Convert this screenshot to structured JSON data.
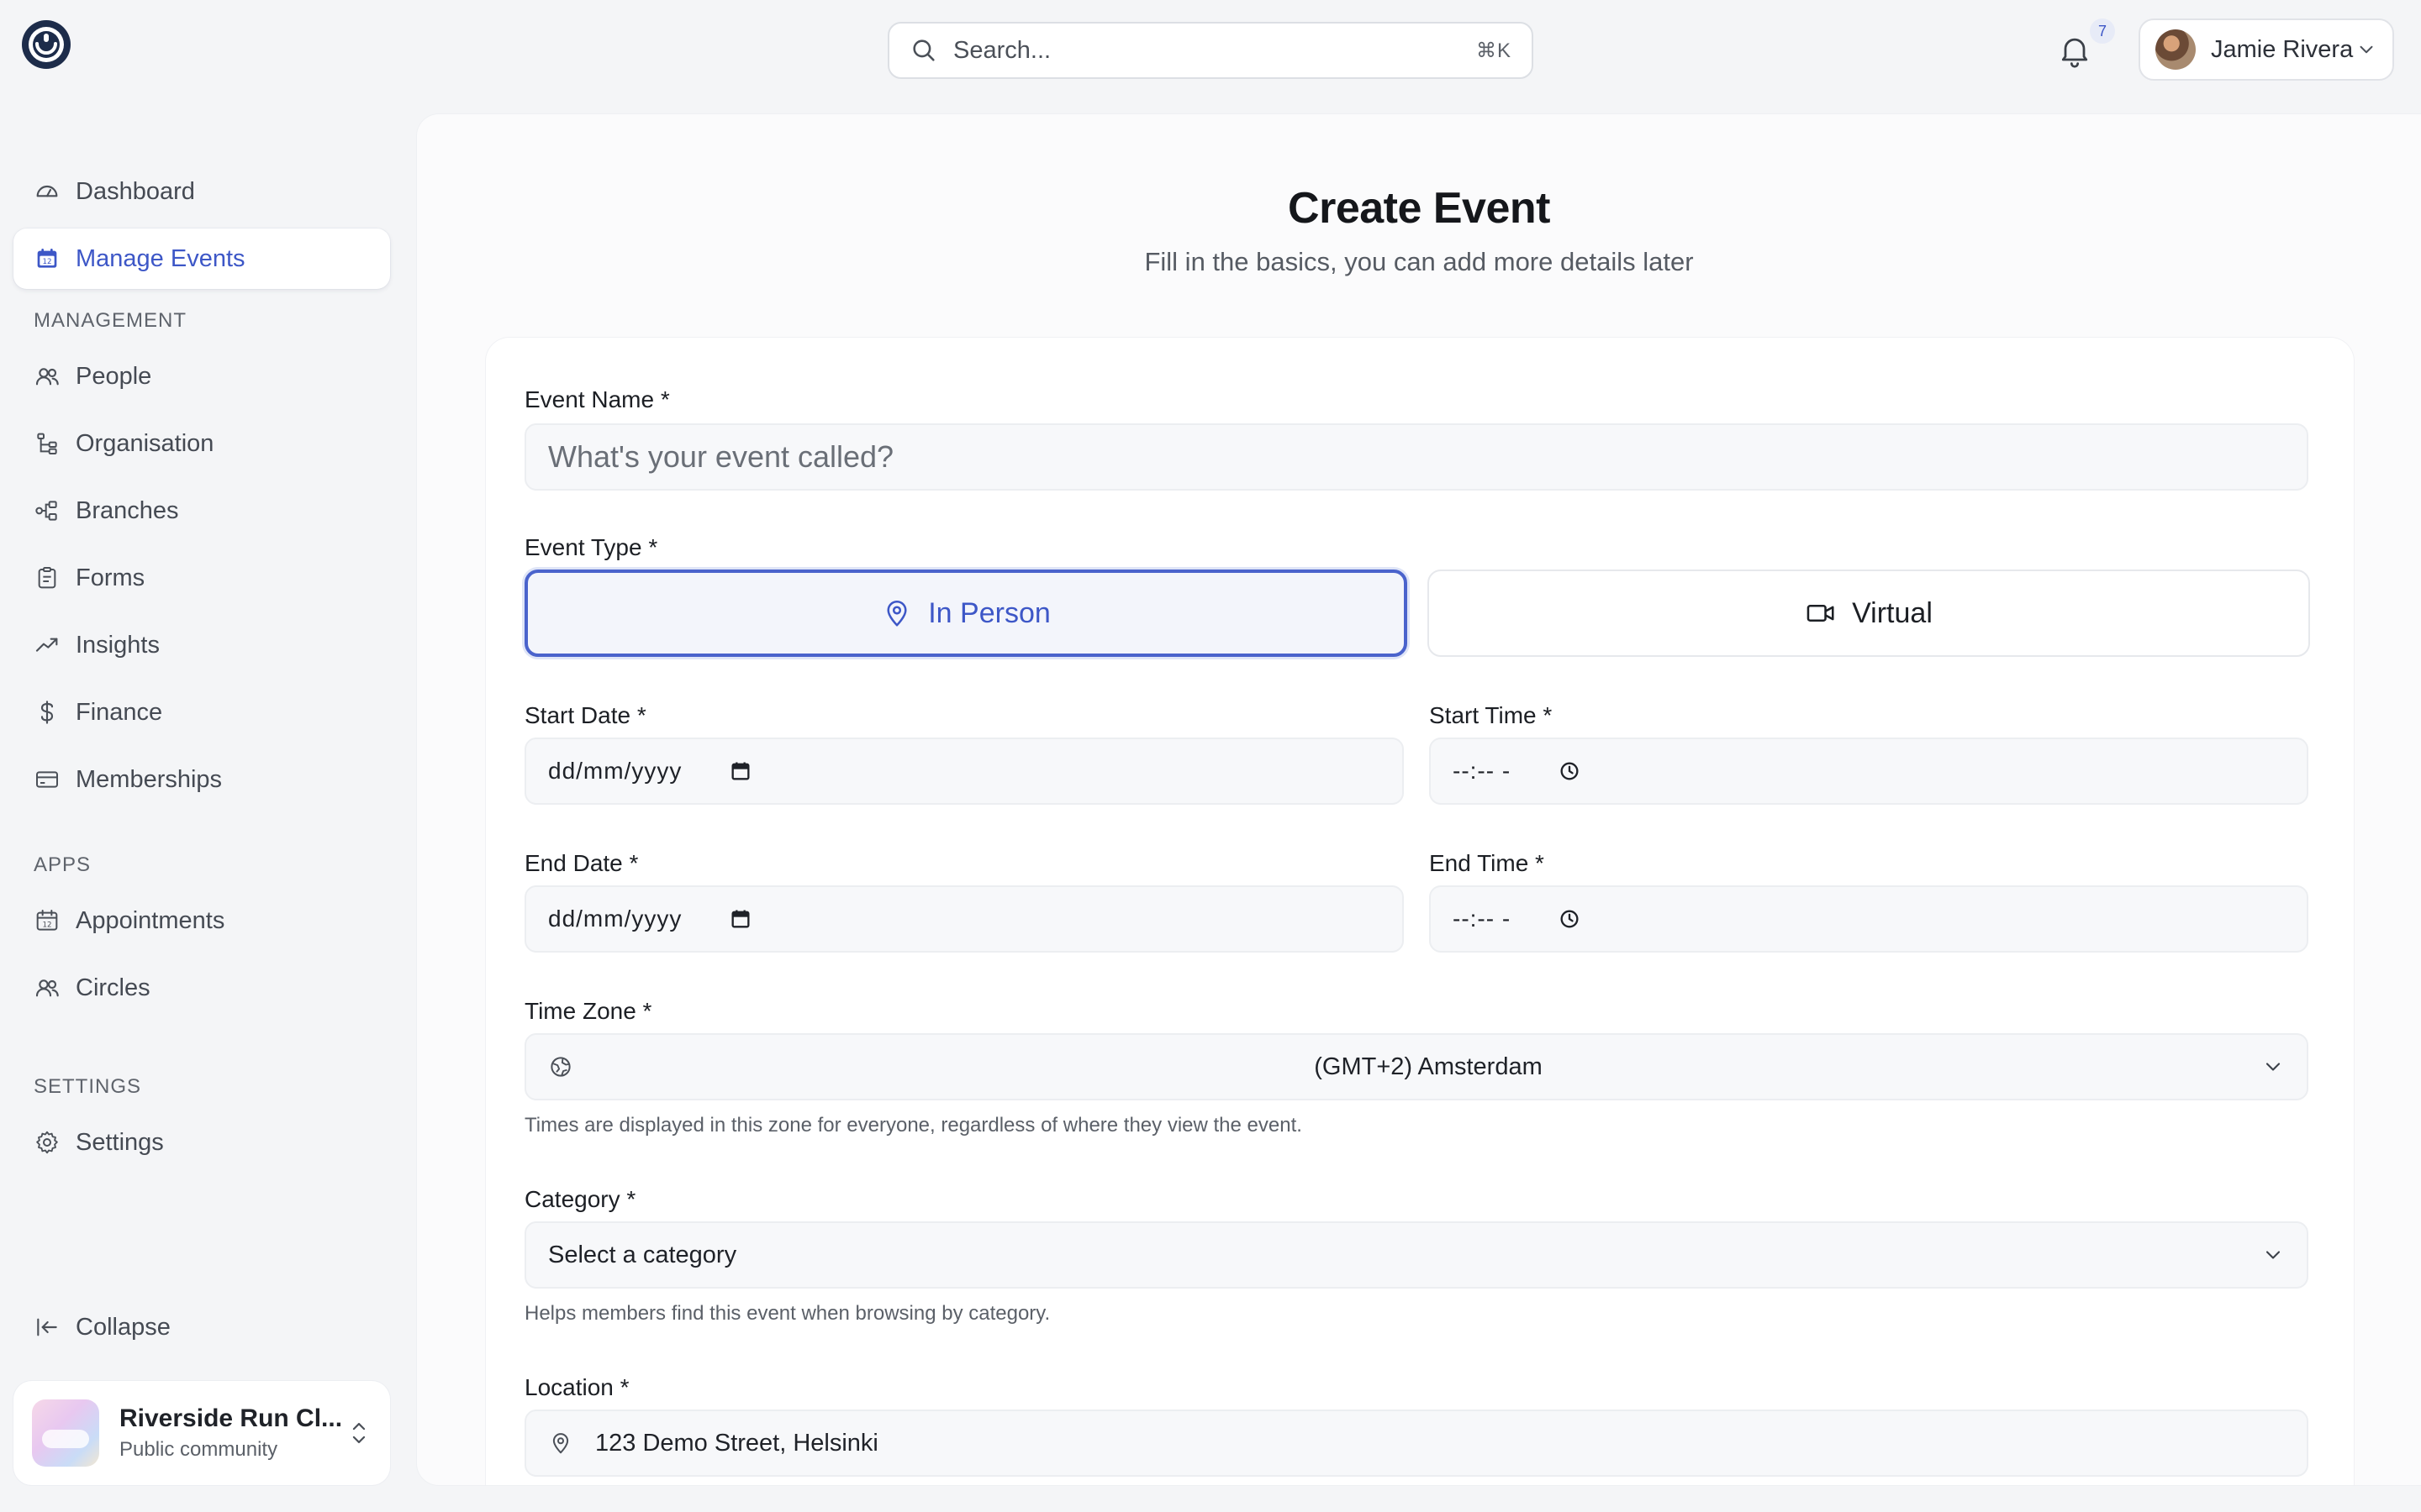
{
  "header": {
    "search_placeholder": "Search...",
    "search_shortcut": "⌘K",
    "notification_count": "7",
    "user_name": "Jamie Rivera"
  },
  "sidebar": {
    "top_items": [
      {
        "label": "Dashboard",
        "icon": "gauge-icon"
      },
      {
        "label": "Manage Events",
        "icon": "calendar-icon",
        "active": true
      }
    ],
    "sections": [
      {
        "title": "MANAGEMENT",
        "items": [
          {
            "label": "People",
            "icon": "people-icon"
          },
          {
            "label": "Organisation",
            "icon": "hierarchy-icon"
          },
          {
            "label": "Branches",
            "icon": "branches-icon"
          },
          {
            "label": "Forms",
            "icon": "clipboard-icon"
          },
          {
            "label": "Insights",
            "icon": "trend-icon"
          },
          {
            "label": "Finance",
            "icon": "dollar-icon"
          },
          {
            "label": "Memberships",
            "icon": "card-icon"
          }
        ]
      },
      {
        "title": "APPS",
        "items": [
          {
            "label": "Appointments",
            "icon": "calendar-icon"
          },
          {
            "label": "Circles",
            "icon": "people-icon"
          }
        ]
      },
      {
        "title": "SETTINGS",
        "items": [
          {
            "label": "Settings",
            "icon": "gear-icon"
          }
        ]
      }
    ],
    "collapse_label": "Collapse",
    "community": {
      "name": "Riverside Run Cl...",
      "subtitle": "Public community"
    }
  },
  "form": {
    "title": "Create Event",
    "subtitle": "Fill in the basics, you can add more details later",
    "event_name": {
      "label": "Event Name *",
      "placeholder": "What's your event called?"
    },
    "event_type": {
      "label": "Event Type *",
      "options": [
        {
          "label": "In Person",
          "icon": "location-pin-icon",
          "selected": true
        },
        {
          "label": "Virtual",
          "icon": "video-camera-icon",
          "selected": false
        }
      ]
    },
    "start_date": {
      "label": "Start Date *",
      "placeholder": "dd/mm/yyyy"
    },
    "start_time": {
      "label": "Start Time *",
      "placeholder": "--:-- -"
    },
    "end_date": {
      "label": "End Date *",
      "placeholder": "dd/mm/yyyy"
    },
    "end_time": {
      "label": "End Time *",
      "placeholder": "--:-- -"
    },
    "time_zone": {
      "label": "Time Zone *",
      "value": "(GMT+2) Amsterdam",
      "hint": "Times are displayed in this zone for everyone, regardless of where they view the event."
    },
    "category": {
      "label": "Category *",
      "value": "Select a category",
      "hint": "Helps members find this event when browsing by category."
    },
    "location": {
      "label": "Location *",
      "value": "123 Demo Street, Helsinki"
    }
  },
  "colors": {
    "accent": "#3d57c7",
    "background": "#f4f5f7",
    "card": "#ffffff"
  }
}
